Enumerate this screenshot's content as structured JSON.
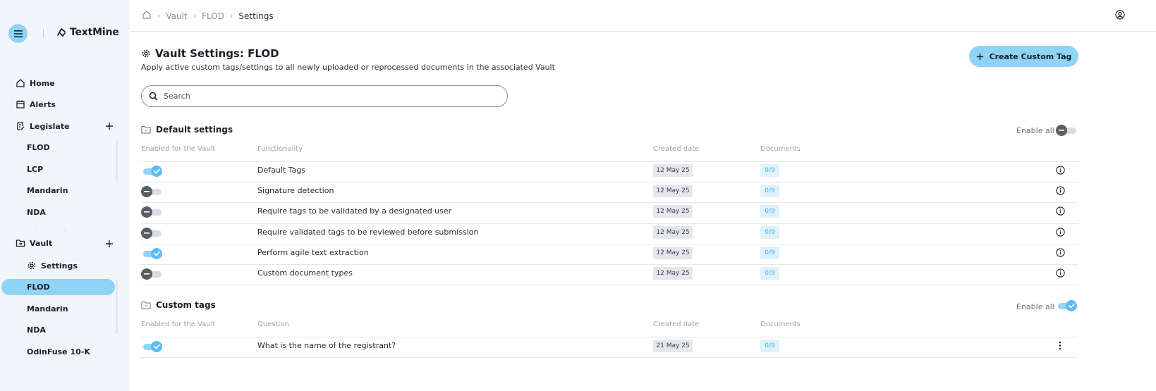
{
  "app": {
    "brand": "TextMine"
  },
  "breadcrumb": {
    "items": [
      "Vault",
      "FLOD"
    ],
    "current": "Settings"
  },
  "sidebar": {
    "home": "Home",
    "alerts": "Alerts",
    "legislate": {
      "label": "Legislate",
      "items": [
        "FLOD",
        "LCP",
        "Mandarin",
        "NDA"
      ]
    },
    "vault": {
      "label": "Vault",
      "settings": "Settings",
      "items": [
        "FLOD",
        "Mandarin",
        "NDA",
        "OdinFuse 10-K"
      ],
      "active": "FLOD"
    }
  },
  "main": {
    "title": "Vault Settings: FLOD",
    "subtitle": "Apply active custom tags/settings to all newly uploaded or reprocessed documents in the associated Vault",
    "create_button": "Create Custom Tag",
    "search_placeholder": "Search"
  },
  "default_settings": {
    "title": "Default settings",
    "enable_all": "Enable all",
    "enable_all_on": false,
    "columns": [
      "Enabled for the Vault",
      "Functionality",
      "Created date",
      "Documents"
    ],
    "rows": [
      {
        "enabled": true,
        "name": "Default Tags",
        "date": "12 May 25",
        "docs": "9/9"
      },
      {
        "enabled": false,
        "name": "Signature detection",
        "date": "12 May 25",
        "docs": "0/9"
      },
      {
        "enabled": false,
        "name": "Require tags to be validated by a designated user",
        "date": "12 May 25",
        "docs": "0/9"
      },
      {
        "enabled": false,
        "name": "Require validated tags to be reviewed before submission",
        "date": "12 May 25",
        "docs": "0/9"
      },
      {
        "enabled": true,
        "name": "Perform agile text extraction",
        "date": "12 May 25",
        "docs": "0/9"
      },
      {
        "enabled": false,
        "name": "Custom document types",
        "date": "12 May 25",
        "docs": "0/9"
      }
    ]
  },
  "custom_tags": {
    "title": "Custom tags",
    "enable_all": "Enable all",
    "enable_all_on": true,
    "columns": [
      "Enabled for the Vault",
      "Question",
      "Created date",
      "Documents"
    ],
    "rows": [
      {
        "enabled": true,
        "name": "What is the name of the registrant?",
        "date": "21 May 25",
        "docs": "0/9"
      }
    ]
  },
  "colors": {
    "accent": "#8fd4f6",
    "toggle_on": "#5dbdf0",
    "sidebar_bg": "#f2f6fa"
  }
}
